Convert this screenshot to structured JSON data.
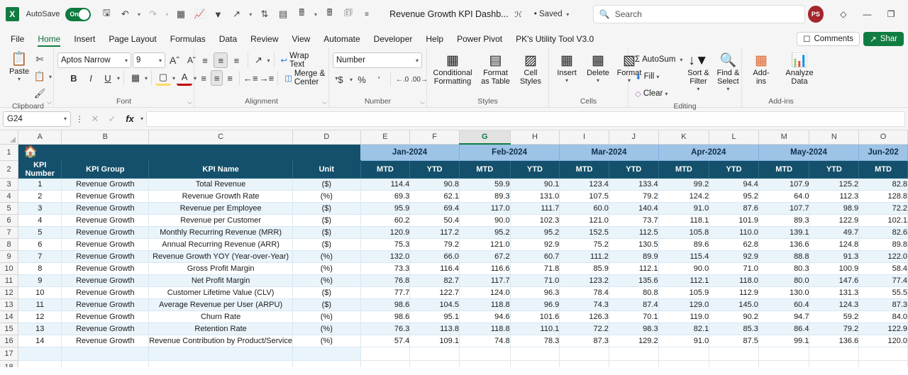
{
  "titlebar": {
    "app_logo": "X",
    "autosave_label": "AutoSave",
    "autosave_state": "On",
    "quick_access": [
      {
        "name": "save-icon",
        "glyph": "὚B"
      },
      {
        "name": "undo-icon",
        "glyph": "↶"
      },
      {
        "name": "redo-icon",
        "glyph": "↷"
      },
      {
        "name": "table-icon",
        "glyph": "⊞"
      },
      {
        "name": "chart-icon",
        "glyph": "Ὄ8"
      },
      {
        "name": "filter-icon",
        "glyph": "∇"
      },
      {
        "name": "share-arrow-icon",
        "glyph": "↪"
      },
      {
        "name": "sort-az-icon",
        "glyph": "↓"
      },
      {
        "name": "grid-icon",
        "glyph": "⌸"
      },
      {
        "name": "calculator-icon",
        "glyph": "὚9"
      },
      {
        "name": "calculator2-icon",
        "glyph": "὚9"
      },
      {
        "name": "form-icon",
        "glyph": "὜A"
      },
      {
        "name": "more-commands-icon",
        "glyph": "≡"
      }
    ],
    "document_title": "Revenue Growth KPI Dashb...",
    "sensitivity_icon": "person-icon",
    "saved_state": "• Saved",
    "search_placeholder": "Search",
    "search_value": "",
    "avatar_initials": "PS",
    "diamond_icon": "diamond-icon",
    "minimize_label": "—",
    "restore_label": "❐"
  },
  "tabs": {
    "items": [
      "File",
      "Home",
      "Insert",
      "Page Layout",
      "Formulas",
      "Data",
      "Review",
      "View",
      "Automate",
      "Developer",
      "Help",
      "Power Pivot",
      "PK's Utility Tool V3.0"
    ],
    "active": "Home",
    "comments_label": "Comments",
    "share_label": "Shar"
  },
  "ribbon": {
    "groups": [
      {
        "name": "Clipboard",
        "paste_label": "Paste",
        "cut_label": "Cut",
        "copy_label": "Copy",
        "format_painter_label": "Format Painter"
      },
      {
        "name": "Font",
        "font_family": "Aptos Narrow",
        "font_size": "9",
        "grow_font": "A˄",
        "shrink_font": "A˅",
        "bold": "B",
        "italic": "I",
        "underline": "U",
        "borders": "Borders",
        "fill_color": "Fill Color",
        "font_color": "Font Color"
      },
      {
        "name": "Alignment",
        "wrap_text_label": "Wrap Text",
        "merge_center_label": "Merge & Center",
        "orientation_label": "Orientation",
        "indent_decrease": "Decrease Indent",
        "indent_increase": "Increase Indent"
      },
      {
        "name": "Number",
        "format_value": "Number",
        "currency": "$",
        "percent": "%",
        "comma": "'",
        "decrease_decimal": "Decrease Decimal",
        "increase_decimal": "Increase Decimal"
      },
      {
        "name": "Styles",
        "conditional_formatting": "Conditional Formatting",
        "format_as_table": "Format as Table",
        "cell_styles": "Cell Styles"
      },
      {
        "name": "Cells",
        "insert": "Insert",
        "delete": "Delete",
        "format": "Format"
      },
      {
        "name": "Editing",
        "autosum": "AutoSum",
        "fill": "Fill",
        "clear": "Clear",
        "sort_filter": "Sort & Filter",
        "find_select": "Find & Select"
      },
      {
        "name": "Add-ins",
        "addins": "Add-ins",
        "analyze_data": "Analyze Data"
      }
    ]
  },
  "formula_bar": {
    "name_box": "G24",
    "cancel_icon": "✕",
    "enter_icon": "✓",
    "function_icon": "fx",
    "formula_value": ""
  },
  "grid": {
    "columns": [
      "A",
      "B",
      "C",
      "D",
      "E",
      "F",
      "G",
      "H",
      "I",
      "J",
      "K",
      "L",
      "M",
      "N",
      "O"
    ],
    "selected_column": "G",
    "row_numbers": [
      1,
      2,
      3,
      4,
      5,
      6,
      7,
      8,
      9,
      10,
      11,
      12,
      13,
      14,
      15,
      16,
      17,
      18
    ],
    "title_row_icon": "home-icon",
    "months": [
      {
        "label": "Jan-2024",
        "cols": [
          "E",
          "F"
        ]
      },
      {
        "label": "Feb-2024",
        "cols": [
          "G",
          "H"
        ]
      },
      {
        "label": "Mar-2024",
        "cols": [
          "I",
          "J"
        ]
      },
      {
        "label": "Apr-2024",
        "cols": [
          "K",
          "L"
        ]
      },
      {
        "label": "May-2024",
        "cols": [
          "M",
          "N"
        ]
      },
      {
        "label": "Jun-202",
        "cols": [
          "O"
        ]
      }
    ],
    "headers": [
      "KPI Number",
      "KPI Group",
      "KPI Name",
      "Unit"
    ],
    "period_headers": [
      "MTD",
      "YTD",
      "MTD",
      "YTD",
      "MTD",
      "YTD",
      "MTD",
      "YTD",
      "MTD",
      "YTD",
      "MTD"
    ],
    "rows": [
      {
        "num": "1",
        "group": "Revenue Growth",
        "name": "Total Revenue",
        "unit": "($)",
        "values": [
          "114.4",
          "90.8",
          "59.9",
          "90.1",
          "123.4",
          "133.4",
          "99.2",
          "94.4",
          "107.9",
          "125.2",
          "82.8"
        ]
      },
      {
        "num": "2",
        "group": "Revenue Growth",
        "name": "Revenue Growth Rate",
        "unit": "(%)",
        "values": [
          "69.3",
          "62.1",
          "89.3",
          "131.0",
          "107.5",
          "79.2",
          "124.2",
          "95.2",
          "64.0",
          "112.3",
          "128.8"
        ]
      },
      {
        "num": "3",
        "group": "Revenue Growth",
        "name": "Revenue per Employee",
        "unit": "($)",
        "values": [
          "95.9",
          "69.4",
          "117.0",
          "111.7",
          "60.0",
          "140.4",
          "91.0",
          "87.6",
          "107.7",
          "98.9",
          "72.2"
        ]
      },
      {
        "num": "4",
        "group": "Revenue Growth",
        "name": "Revenue per Customer",
        "unit": "($)",
        "values": [
          "60.2",
          "50.4",
          "90.0",
          "102.3",
          "121.0",
          "73.7",
          "118.1",
          "101.9",
          "89.3",
          "122.9",
          "102.1"
        ]
      },
      {
        "num": "5",
        "group": "Revenue Growth",
        "name": "Monthly Recurring Revenue (MRR)",
        "unit": "($)",
        "values": [
          "120.9",
          "117.2",
          "95.2",
          "95.2",
          "152.5",
          "112.5",
          "105.8",
          "110.0",
          "139.1",
          "49.7",
          "82.6"
        ]
      },
      {
        "num": "6",
        "group": "Revenue Growth",
        "name": "Annual Recurring Revenue (ARR)",
        "unit": "($)",
        "values": [
          "75.3",
          "79.2",
          "121.0",
          "92.9",
          "75.2",
          "130.5",
          "89.6",
          "62.8",
          "136.6",
          "124.8",
          "89.8"
        ]
      },
      {
        "num": "7",
        "group": "Revenue Growth",
        "name": "Revenue Growth YOY (Year-over-Year)",
        "unit": "(%)",
        "values": [
          "132.0",
          "66.0",
          "67.2",
          "60.7",
          "111.2",
          "89.9",
          "115.4",
          "92.9",
          "88.8",
          "91.3",
          "122.0"
        ]
      },
      {
        "num": "8",
        "group": "Revenue Growth",
        "name": "Gross Profit Margin",
        "unit": "(%)",
        "values": [
          "73.3",
          "116.4",
          "116.6",
          "71.8",
          "85.9",
          "112.1",
          "90.0",
          "71.0",
          "80.3",
          "100.9",
          "58.4"
        ]
      },
      {
        "num": "9",
        "group": "Revenue Growth",
        "name": "Net Profit Margin",
        "unit": "(%)",
        "values": [
          "76.8",
          "82.7",
          "117.7",
          "71.0",
          "123.2",
          "135.6",
          "112.1",
          "118.0",
          "80.0",
          "147.6",
          "77.4"
        ]
      },
      {
        "num": "10",
        "group": "Revenue Growth",
        "name": "Customer Lifetime Value (CLV)",
        "unit": "($)",
        "values": [
          "77.7",
          "122.7",
          "124.0",
          "96.3",
          "78.4",
          "80.8",
          "105.9",
          "112.9",
          "130.0",
          "131.3",
          "55.5"
        ]
      },
      {
        "num": "11",
        "group": "Revenue Growth",
        "name": "Average Revenue per User (ARPU)",
        "unit": "($)",
        "values": [
          "98.6",
          "104.5",
          "118.8",
          "96.9",
          "74.3",
          "87.4",
          "129.0",
          "145.0",
          "60.4",
          "124.3",
          "87.3"
        ]
      },
      {
        "num": "12",
        "group": "Revenue Growth",
        "name": "Churn Rate",
        "unit": "(%)",
        "values": [
          "98.6",
          "95.1",
          "94.6",
          "101.6",
          "126.3",
          "70.1",
          "119.0",
          "90.2",
          "94.7",
          "59.2",
          "84.0"
        ]
      },
      {
        "num": "13",
        "group": "Revenue Growth",
        "name": "Retention Rate",
        "unit": "(%)",
        "values": [
          "76.3",
          "113.8",
          "118.8",
          "110.1",
          "72.2",
          "98.3",
          "82.1",
          "85.3",
          "86.4",
          "79.2",
          "122.9"
        ]
      },
      {
        "num": "14",
        "group": "Revenue Growth",
        "name": "Revenue Contribution by Product/Service",
        "unit": "(%)",
        "values": [
          "57.4",
          "109.1",
          "74.8",
          "78.3",
          "87.3",
          "129.2",
          "91.0",
          "87.5",
          "99.1",
          "136.6",
          "120.0"
        ]
      }
    ]
  }
}
